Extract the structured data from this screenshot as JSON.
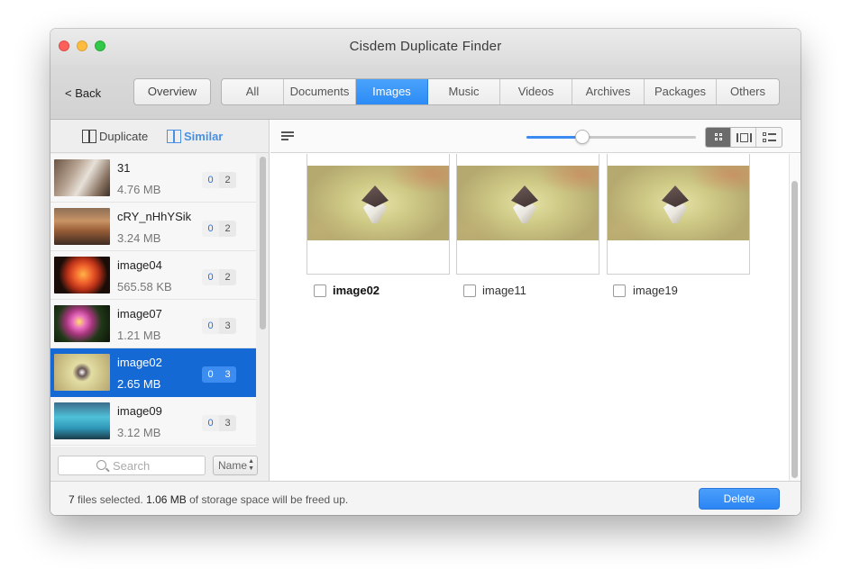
{
  "window": {
    "title": "Cisdem Duplicate Finder"
  },
  "toolbar": {
    "back_label": "< Back",
    "overview_label": "Overview",
    "categories": [
      {
        "label": "All",
        "active": false
      },
      {
        "label": "Documents",
        "active": false
      },
      {
        "label": "Images",
        "active": true
      },
      {
        "label": "Music",
        "active": false
      },
      {
        "label": "Videos",
        "active": false
      },
      {
        "label": "Archives",
        "active": false
      },
      {
        "label": "Packages",
        "active": false
      },
      {
        "label": "Others",
        "active": false
      }
    ]
  },
  "modes": {
    "duplicate_label": "Duplicate",
    "similar_label": "Similar",
    "active": "similar"
  },
  "file_list": [
    {
      "name": "31",
      "size": "4.76 MB",
      "selected_count": "0",
      "total_count": "2",
      "selected": false,
      "thumb_icon": "books-photo-icon"
    },
    {
      "name": "cRY_nHhYSik",
      "size": "3.24 MB",
      "selected_count": "0",
      "total_count": "2",
      "selected": false,
      "thumb_icon": "mountain-photo-icon"
    },
    {
      "name": "image04",
      "size": "565.58 KB",
      "selected_count": "0",
      "total_count": "2",
      "selected": false,
      "thumb_icon": "lily-photo-icon"
    },
    {
      "name": "image07",
      "size": "1.21 MB",
      "selected_count": "0",
      "total_count": "3",
      "selected": false,
      "thumb_icon": "flower-photo-icon"
    },
    {
      "name": "image02",
      "size": "2.65 MB",
      "selected_count": "0",
      "total_count": "3",
      "selected": true,
      "thumb_icon": "boat-aerial-photo-icon"
    },
    {
      "name": "image09",
      "size": "3.12 MB",
      "selected_count": "0",
      "total_count": "3",
      "selected": false,
      "thumb_icon": "lake-photo-icon"
    }
  ],
  "search": {
    "placeholder": "Search"
  },
  "sort": {
    "selected": "Name"
  },
  "view": {
    "thumbnail_size": 0.33,
    "mode": "grid"
  },
  "images": [
    {
      "name": "image02",
      "checked": false,
      "bold": true
    },
    {
      "name": "image11",
      "checked": false,
      "bold": false
    },
    {
      "name": "image19",
      "checked": false,
      "bold": false
    }
  ],
  "status": {
    "count": "7",
    "files_text": " files selected. ",
    "size": "1.06 MB",
    "suffix": " of storage space will be freed up."
  },
  "actions": {
    "delete_label": "Delete"
  },
  "colors": {
    "accent": "#2c8bf6",
    "selection": "#1469d5"
  }
}
